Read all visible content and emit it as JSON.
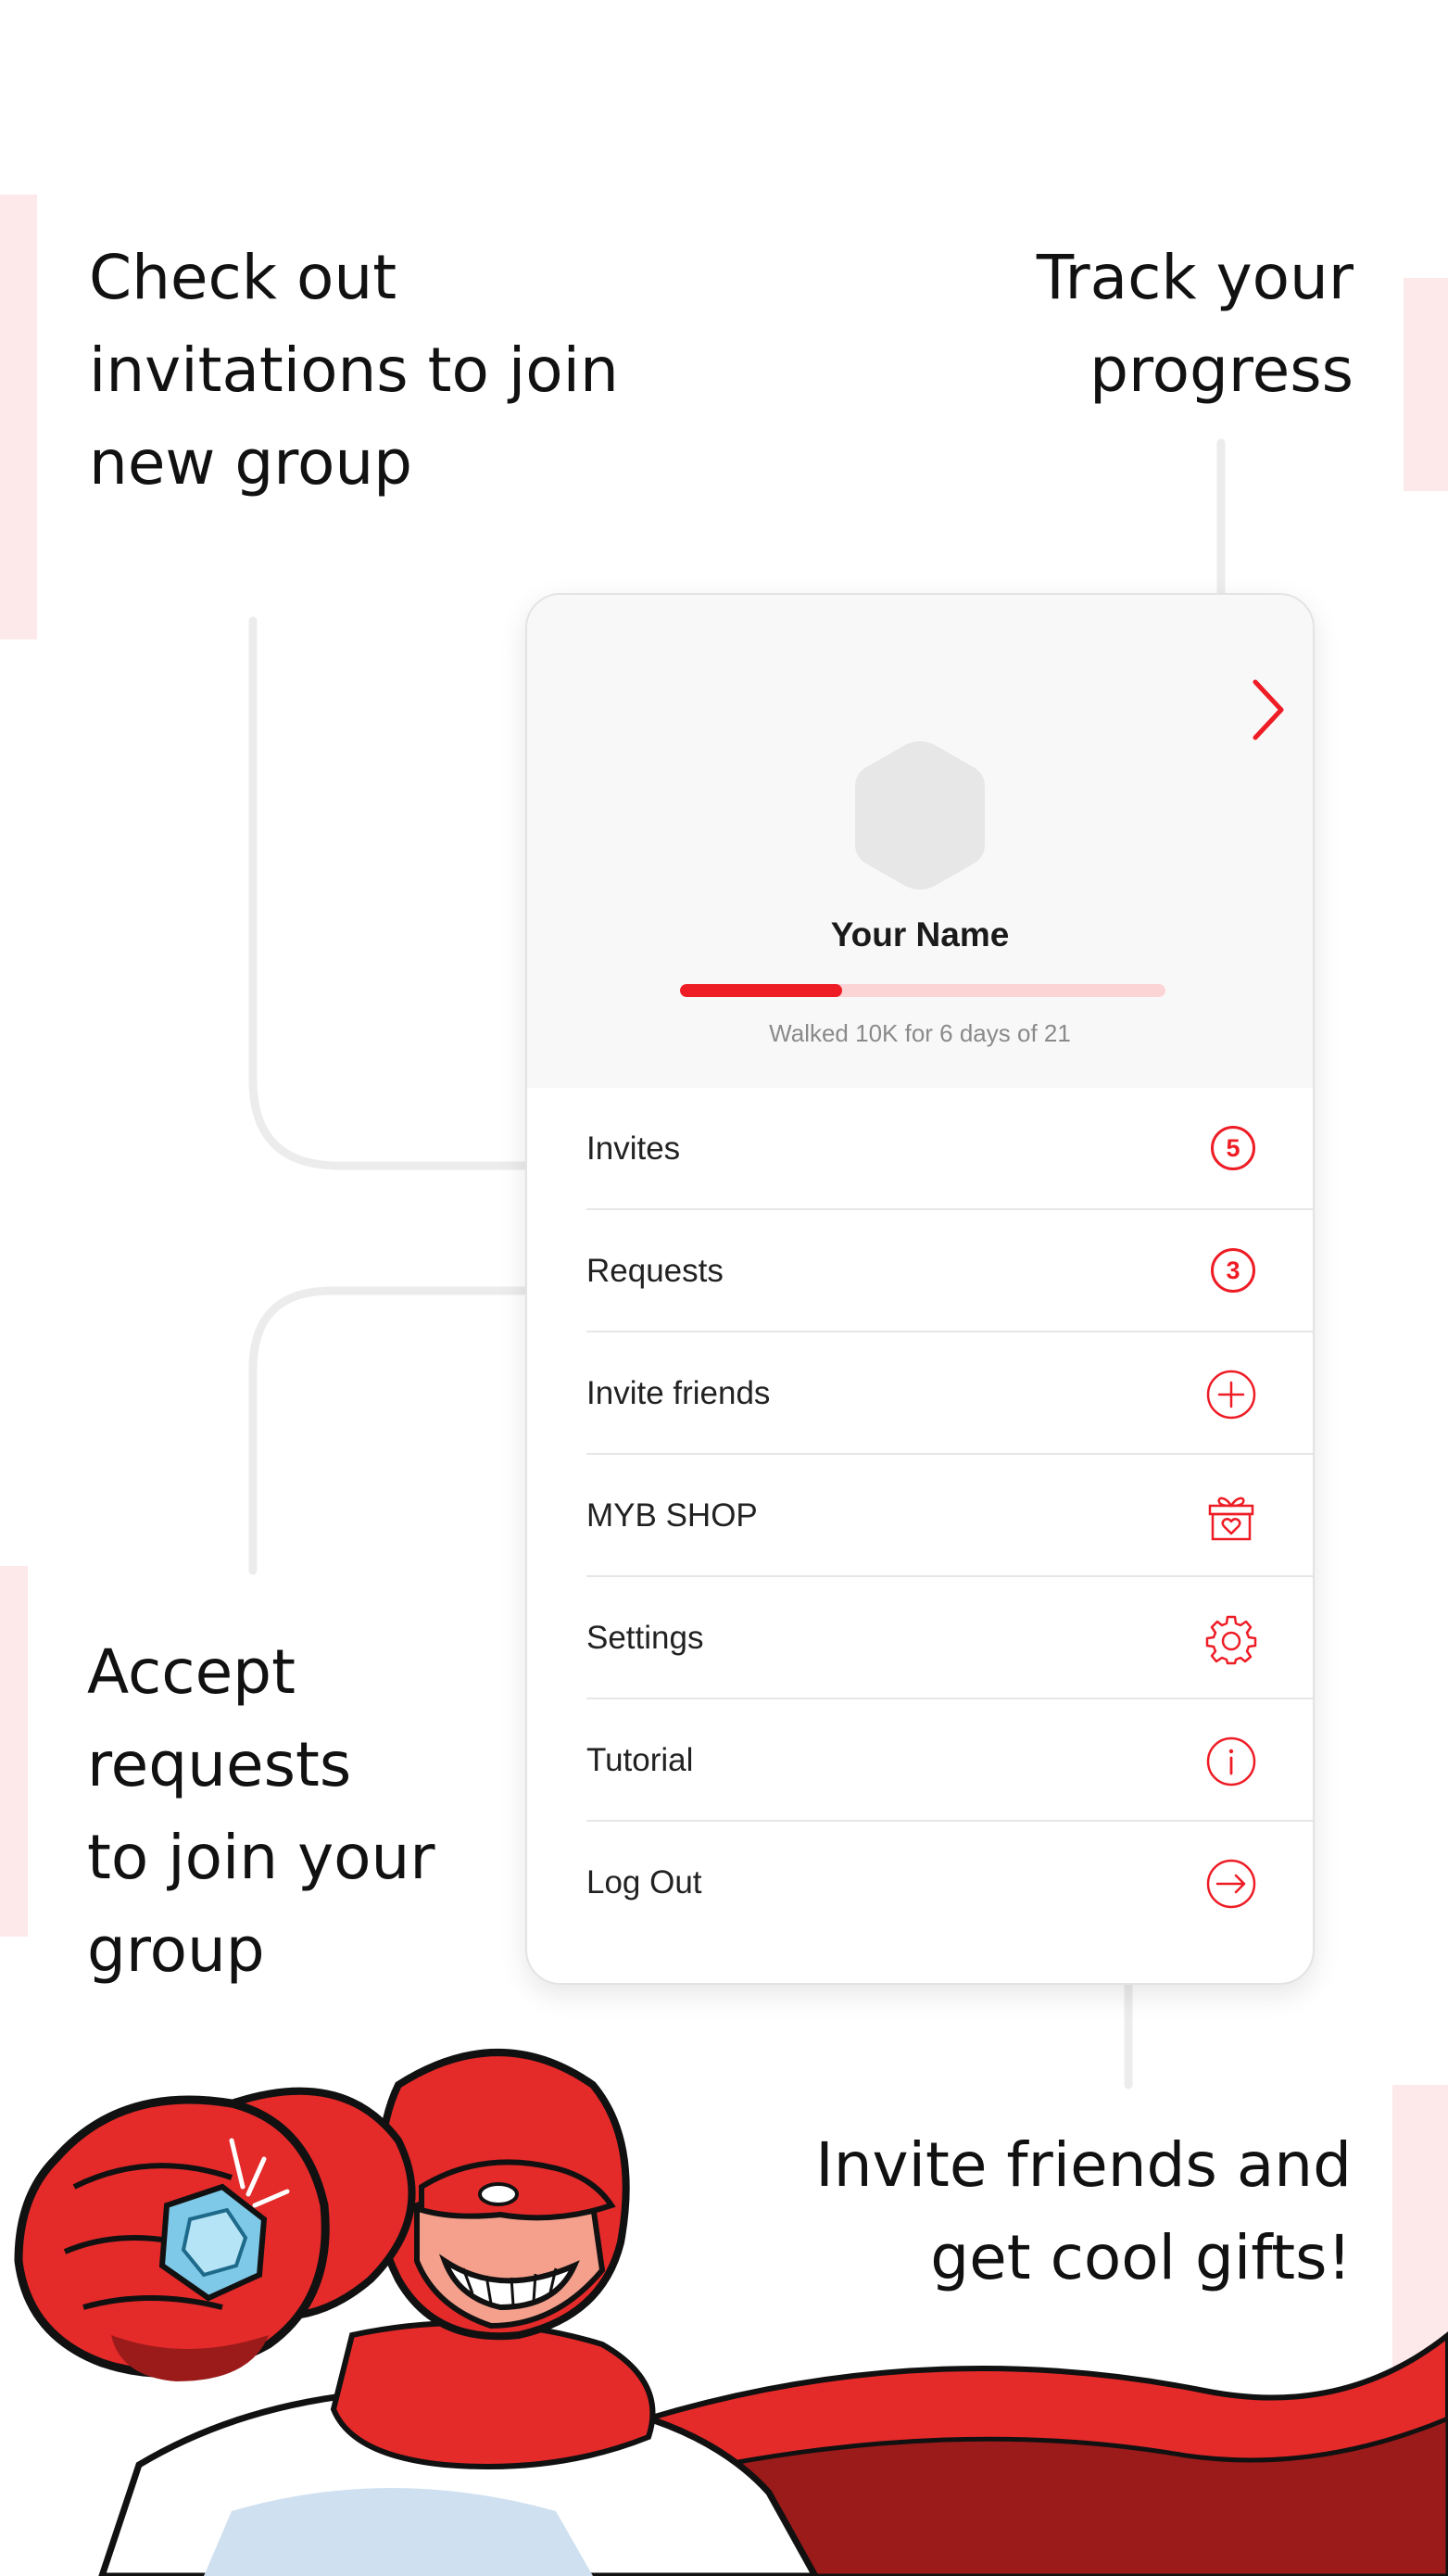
{
  "callouts": {
    "invitations": [
      "Check out",
      "invitations to join",
      "new group"
    ],
    "progress": [
      "Track your",
      "progress"
    ],
    "requests": [
      "Accept",
      "requests",
      "to join your",
      "group"
    ],
    "gifts": [
      "Invite friends and",
      "get cool gifts!"
    ]
  },
  "profile": {
    "name": "Your Name",
    "progress_caption": "Walked 10K for 6 days of 21",
    "progress_fraction": 0.3333
  },
  "menu": {
    "items": [
      {
        "label": "Invites",
        "badge": "5",
        "icon": "badge-icon"
      },
      {
        "label": "Requests",
        "badge": "3",
        "icon": "badge-icon"
      },
      {
        "label": "Invite friends",
        "icon": "plus-circle-icon"
      },
      {
        "label": "MYB SHOP",
        "icon": "gift-icon"
      },
      {
        "label": "Settings",
        "icon": "gear-icon"
      },
      {
        "label": "Tutorial",
        "icon": "info-icon"
      },
      {
        "label": "Log Out",
        "icon": "logout-icon"
      }
    ]
  },
  "colors": {
    "accent": "#ee1c25",
    "accent_light": "#fbd4d6",
    "header_bg": "#f8f8f8",
    "connector": "#ececec"
  }
}
